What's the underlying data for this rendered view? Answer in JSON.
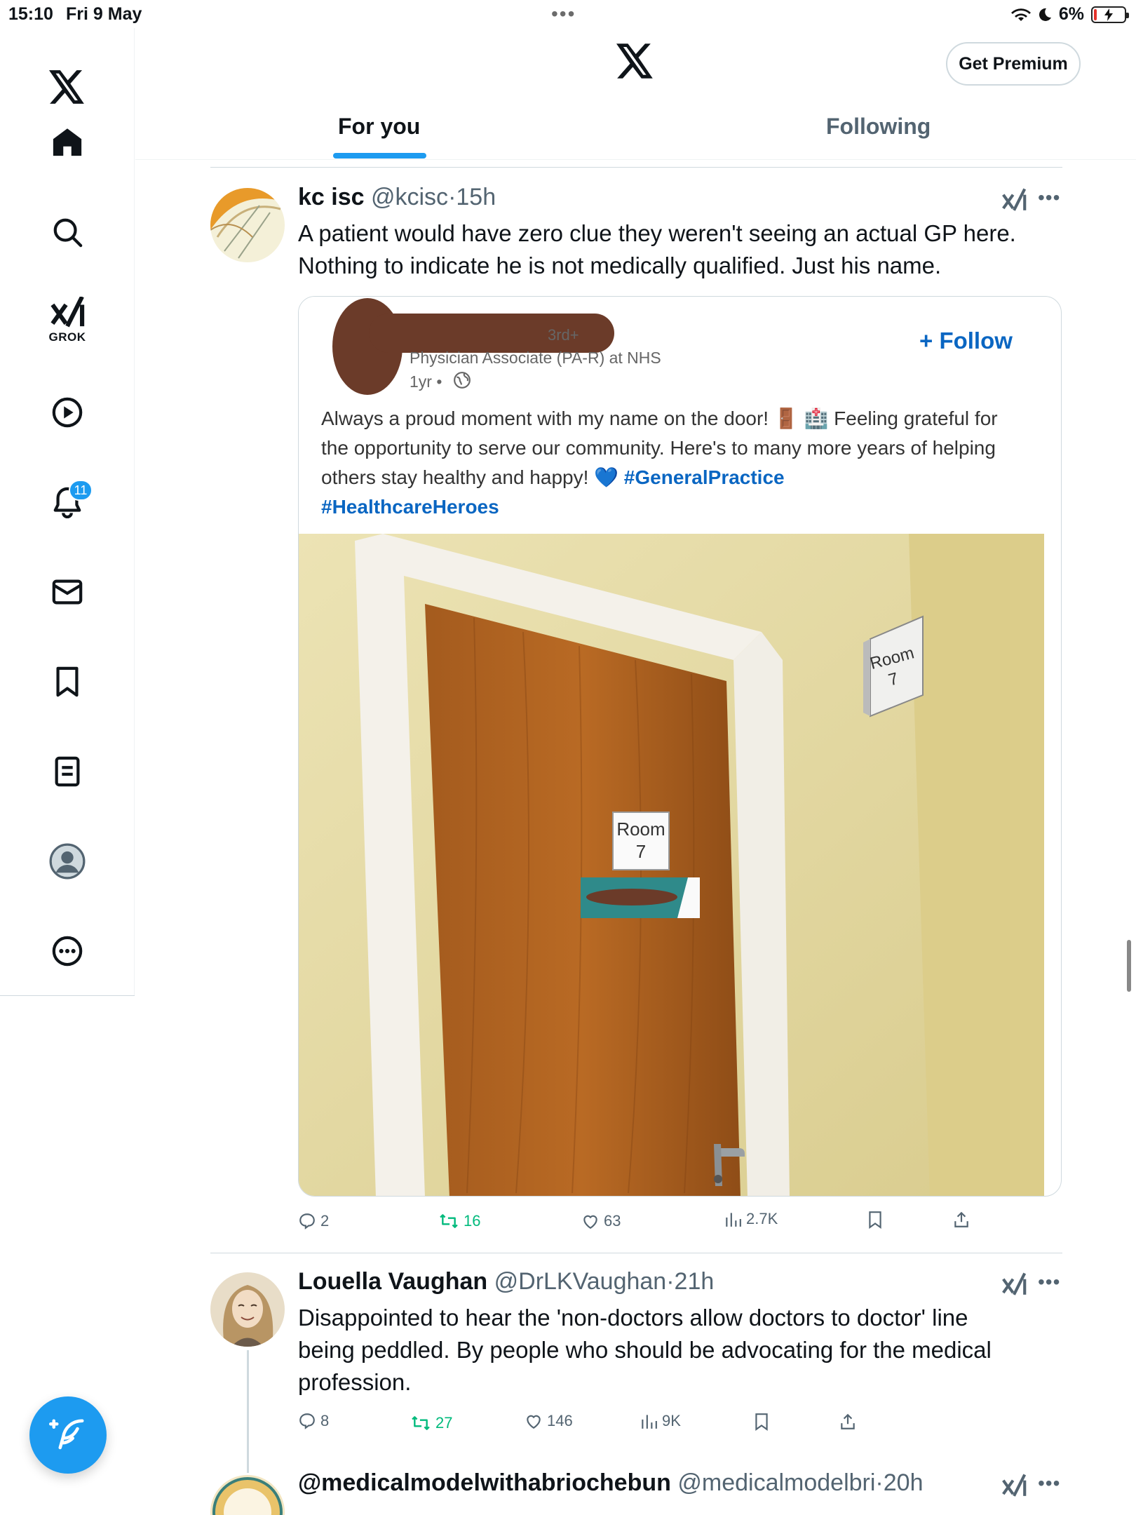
{
  "status_bar": {
    "time": "15:10",
    "date": "Fri 9 May",
    "dots": "•••",
    "battery": "6%"
  },
  "header": {
    "premium_label": "Get Premium",
    "tabs": [
      {
        "label": "For you",
        "active": true
      },
      {
        "label": "Following",
        "active": false
      }
    ]
  },
  "sidebar": {
    "grok_label": "GROK",
    "notifications_count": "11"
  },
  "tweets": [
    {
      "name": "kc isc",
      "handle": "@kcisc",
      "time": "15h",
      "text_line1": "A patient would have zero clue they weren't seeing an actual GP here.",
      "text_line2": "Nothing to indicate he is not medically qualified. Just his name.",
      "embed": {
        "degree": "3rd+",
        "headline": "Physician Associate (PA-R) at NHS",
        "age": "1yr •",
        "follow_label": "+ Follow",
        "post_text": "Always a proud moment with my name on the door! 🚪 🏥 Feeling grateful for the opportunity to serve our community. Here's to many more years of helping others stay healthy and happy! 💙 ",
        "hashtag1": "#GeneralPractice",
        "hashtag2": "#HealthcareHeroes",
        "sign_door": "Room 7",
        "sign_wall": "Room 7"
      },
      "replies": "2",
      "retweets": "16",
      "likes": "63",
      "views": "2.7K"
    },
    {
      "name": "Louella Vaughan",
      "handle": "@DrLKVaughan",
      "time": "21h",
      "text_line1": "Disappointed to hear the 'non-doctors allow doctors to doctor' line",
      "text_line2": "being peddled. By people who should be advocating for the medical",
      "text_line3": "profession.",
      "replies": "8",
      "retweets": "27",
      "likes": "146",
      "views": "9K"
    },
    {
      "name": "@medicalmodelwithabriochebun",
      "handle": "@medicalmodelbri",
      "time": "20h"
    }
  ],
  "colors": {
    "accent": "#1d9bf0",
    "retweet": "#00ba7c",
    "linkedin": "#0a66c2",
    "text": "#0f1419",
    "muted": "#536471"
  }
}
